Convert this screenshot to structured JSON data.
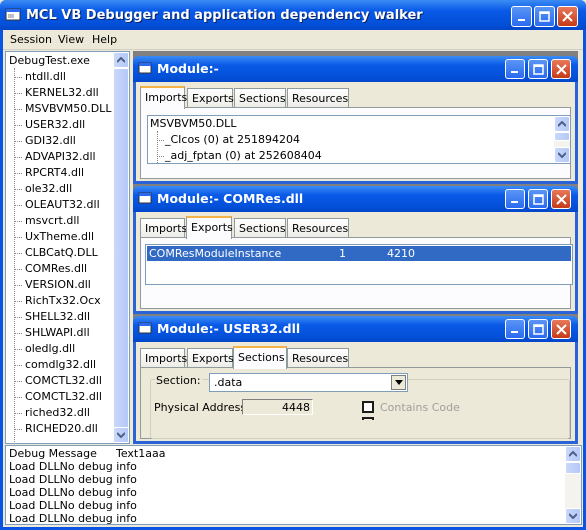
{
  "app": {
    "title": "MCL VB Debugger and application dependency walker"
  },
  "menu": [
    "Session",
    "View",
    "Help"
  ],
  "tree": {
    "root": "DebugTest.exe",
    "items": [
      "ntdll.dll",
      "KERNEL32.dll",
      "MSVBVM50.DLL",
      "USER32.dll",
      "GDI32.dll",
      "ADVAPI32.dll",
      "RPCRT4.dll",
      "ole32.dll",
      "OLEAUT32.dll",
      "msvcrt.dll",
      "UxTheme.dll",
      "CLBCatQ.DLL",
      "COMRes.dll",
      "VERSION.dll",
      "RichTx32.Ocx",
      "SHELL32.dll",
      "SHLWAPI.dll",
      "oledlg.dll",
      "comdlg32.dll",
      "COMCTL32.dll",
      "COMCTL32.dll",
      "riched32.dll",
      "RICHED20.dll"
    ]
  },
  "module1": {
    "title": "Module:-",
    "tabs": [
      "Imports",
      "Exports",
      "Sections",
      "Resources"
    ],
    "active_tab": "Imports",
    "import_root": "MSVBVM50.DLL",
    "imports": [
      "_CIcos (0) at 251894204",
      "_adj_fptan (0) at 252608404"
    ]
  },
  "module2": {
    "title": "Module:- COMRes.dll",
    "tabs": [
      "Imports",
      "Exports",
      "Sections",
      "Resources"
    ],
    "active_tab": "Exports",
    "export_row": {
      "name": "COMResModuleInstance",
      "ordinal": "1",
      "address": "4210"
    }
  },
  "module3": {
    "title": "Module:- USER32.dll",
    "tabs": [
      "Imports",
      "Exports",
      "Sections",
      "Resources"
    ],
    "active_tab": "Sections",
    "section_label": "Section:",
    "section_value": ".data",
    "physical_address_label": "Physical Address",
    "physical_address_value": "4448",
    "contains_code_label": "Contains Code",
    "contains_code_checked": false
  },
  "log": {
    "header": [
      "Debug Message",
      "Text1aaa"
    ],
    "lines": [
      "Load DLLNo debug info",
      "Load DLLNo debug info",
      "Load DLLNo debug info",
      "Load DLLNo debug info",
      "Load DLLNo debug info"
    ]
  },
  "colors": {
    "titlebar": "#0a5ae8",
    "selection": "#316ac5",
    "face": "#ece9d8"
  }
}
